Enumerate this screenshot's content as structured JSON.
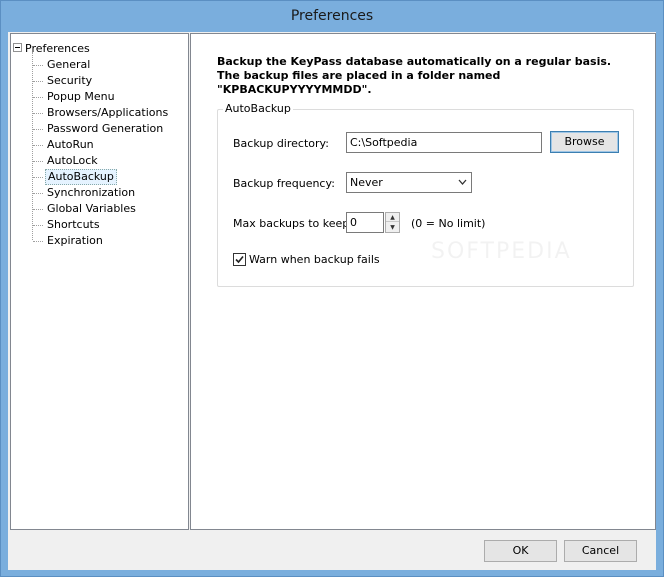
{
  "window": {
    "title": "Preferences"
  },
  "tree": {
    "root": "Preferences",
    "items": [
      {
        "label": "General"
      },
      {
        "label": "Security"
      },
      {
        "label": "Popup Menu"
      },
      {
        "label": "Browsers/Applications"
      },
      {
        "label": "Password Generation"
      },
      {
        "label": "AutoRun"
      },
      {
        "label": "AutoLock"
      },
      {
        "label": "AutoBackup",
        "selected": true
      },
      {
        "label": "Synchronization"
      },
      {
        "label": "Global Variables"
      },
      {
        "label": "Shortcuts"
      },
      {
        "label": "Expiration"
      }
    ]
  },
  "panel": {
    "description": "Backup the KeyPass database automatically on a regular basis. The backup files are placed in a folder named \"KPBACKUPYYYYMMDD\".",
    "group_title": "AutoBackup",
    "directory_label": "Backup directory:",
    "directory_value": "C:\\Softpedia",
    "browse_label": "Browse",
    "frequency_label": "Backup frequency:",
    "frequency_value": "Never",
    "max_label": "Max backups to keep:",
    "max_value": "0",
    "max_hint": "(0 = No limit)",
    "warn_label": "Warn when backup fails",
    "warn_checked": true
  },
  "footer": {
    "ok_label": "OK",
    "cancel_label": "Cancel"
  },
  "watermark": "SOFTPEDIA",
  "icons": {
    "expander": "minus-expander-icon",
    "dropdown": "chevron-down-icon",
    "check": "check-icon",
    "spin_up": "spin-up-icon",
    "spin_down": "spin-down-icon"
  }
}
